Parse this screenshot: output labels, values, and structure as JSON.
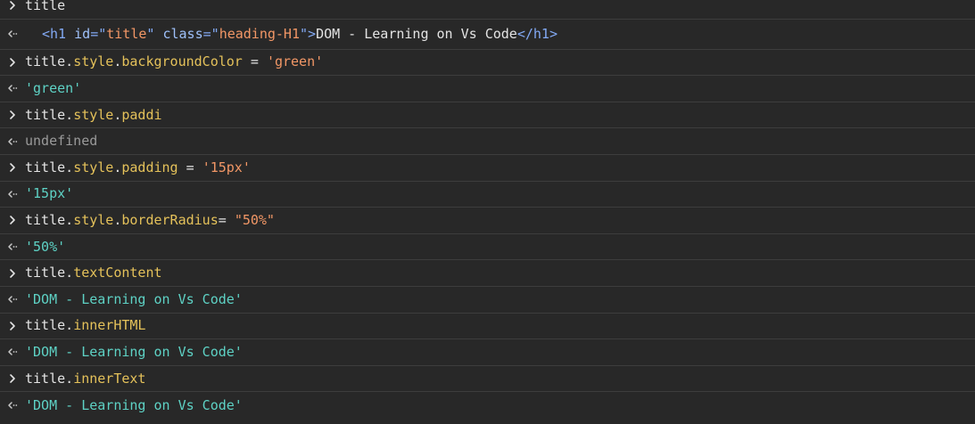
{
  "colors": {
    "background": "#282828",
    "separator": "#3d3d3d",
    "plain": "#e3e3e3",
    "property": "#e4c15a",
    "input_string": "#f29766",
    "result_string": "#5ed2c5",
    "undefined": "#9a9a9a",
    "tag": "#83aaf5"
  },
  "icons": {
    "input": "chevron-right-icon",
    "output": "return-arrow-icon"
  },
  "entries": [
    {
      "kind": "input",
      "parts": [
        {
          "t": "title",
          "c": "plain"
        }
      ]
    },
    {
      "kind": "output",
      "tall": true,
      "parts": [
        {
          "t": "<h1",
          "c": "tag"
        },
        {
          "t": " id",
          "c": "attr"
        },
        {
          "t": "=\"",
          "c": "tag"
        },
        {
          "t": "title",
          "c": "attrv"
        },
        {
          "t": "\"",
          "c": "tag"
        },
        {
          "t": " class",
          "c": "attr"
        },
        {
          "t": "=\"",
          "c": "tag"
        },
        {
          "t": "heading-H1",
          "c": "attrv"
        },
        {
          "t": "\">",
          "c": "tag"
        },
        {
          "t": "DOM - Learning on Vs Code",
          "c": "plain"
        },
        {
          "t": "</h1>",
          "c": "tag"
        }
      ]
    },
    {
      "kind": "input",
      "parts": [
        {
          "t": "title",
          "c": "plain"
        },
        {
          "t": ".",
          "c": "plain"
        },
        {
          "t": "style",
          "c": "prop"
        },
        {
          "t": ".",
          "c": "plain"
        },
        {
          "t": "backgroundColor",
          "c": "prop"
        },
        {
          "t": " = ",
          "c": "plain"
        },
        {
          "t": "'green'",
          "c": "str"
        }
      ]
    },
    {
      "kind": "output",
      "parts": [
        {
          "t": "'green'",
          "c": "res"
        }
      ]
    },
    {
      "kind": "input",
      "parts": [
        {
          "t": "title",
          "c": "plain"
        },
        {
          "t": ".",
          "c": "plain"
        },
        {
          "t": "style",
          "c": "prop"
        },
        {
          "t": ".",
          "c": "plain"
        },
        {
          "t": "paddi",
          "c": "prop"
        }
      ]
    },
    {
      "kind": "output",
      "parts": [
        {
          "t": "undefined",
          "c": "undef"
        }
      ]
    },
    {
      "kind": "input",
      "parts": [
        {
          "t": "title",
          "c": "plain"
        },
        {
          "t": ".",
          "c": "plain"
        },
        {
          "t": "style",
          "c": "prop"
        },
        {
          "t": ".",
          "c": "plain"
        },
        {
          "t": "padding",
          "c": "prop"
        },
        {
          "t": " = ",
          "c": "plain"
        },
        {
          "t": "'15px'",
          "c": "str"
        }
      ]
    },
    {
      "kind": "output",
      "parts": [
        {
          "t": "'15px'",
          "c": "res"
        }
      ]
    },
    {
      "kind": "input",
      "parts": [
        {
          "t": "title",
          "c": "plain"
        },
        {
          "t": ".",
          "c": "plain"
        },
        {
          "t": "style",
          "c": "prop"
        },
        {
          "t": ".",
          "c": "plain"
        },
        {
          "t": "borderRadius",
          "c": "prop"
        },
        {
          "t": "= ",
          "c": "plain"
        },
        {
          "t": "\"50%\"",
          "c": "str"
        }
      ]
    },
    {
      "kind": "output",
      "parts": [
        {
          "t": "'50%'",
          "c": "res"
        }
      ]
    },
    {
      "kind": "input",
      "parts": [
        {
          "t": "title",
          "c": "plain"
        },
        {
          "t": ".",
          "c": "plain"
        },
        {
          "t": "textContent",
          "c": "prop"
        }
      ]
    },
    {
      "kind": "output",
      "parts": [
        {
          "t": "'DOM - Learning on Vs Code'",
          "c": "res"
        }
      ]
    },
    {
      "kind": "input",
      "parts": [
        {
          "t": "title",
          "c": "plain"
        },
        {
          "t": ".",
          "c": "plain"
        },
        {
          "t": "innerHTML",
          "c": "prop"
        }
      ]
    },
    {
      "kind": "output",
      "parts": [
        {
          "t": "'DOM - Learning on Vs Code'",
          "c": "res"
        }
      ]
    },
    {
      "kind": "input",
      "parts": [
        {
          "t": "title",
          "c": "plain"
        },
        {
          "t": ".",
          "c": "plain"
        },
        {
          "t": "innerText",
          "c": "prop"
        }
      ]
    },
    {
      "kind": "output",
      "parts": [
        {
          "t": "'DOM - Learning on Vs Code'",
          "c": "res"
        }
      ]
    }
  ]
}
